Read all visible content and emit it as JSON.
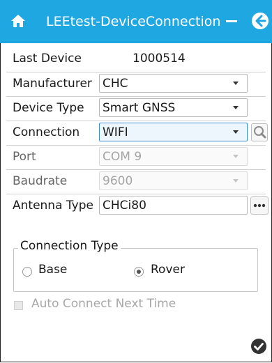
{
  "header": {
    "title": "LEEtest-DeviceConnection",
    "background_color": "#1ea7e1",
    "home_icon": "home-icon",
    "minimize_icon": "minimize-icon",
    "back_icon": "back-arrow-icon"
  },
  "last_device": {
    "label": "Last Device",
    "value": "1000514"
  },
  "form": {
    "manufacturer": {
      "label": "Manufacturer",
      "value": "CHC"
    },
    "device_type": {
      "label": "Device Type",
      "value": "Smart GNSS"
    },
    "connection": {
      "label": "Connection",
      "value": "WIFI",
      "search_icon": "search-icon"
    },
    "port": {
      "label": "Port",
      "value": "COM 9"
    },
    "baudrate": {
      "label": "Baudrate",
      "value": "9600"
    },
    "antenna_type": {
      "label": "Antenna Type",
      "value": "CHCi80",
      "more_icon": "more-icon"
    }
  },
  "connection_type": {
    "legend": "Connection Type",
    "options": [
      {
        "label": "Base",
        "checked": false
      },
      {
        "label": "Rover",
        "checked": true
      }
    ]
  },
  "auto_connect": {
    "label": "Auto Connect Next Time",
    "checked": false,
    "enabled": false
  },
  "footer": {
    "confirm_icon": "check-circle-icon"
  }
}
